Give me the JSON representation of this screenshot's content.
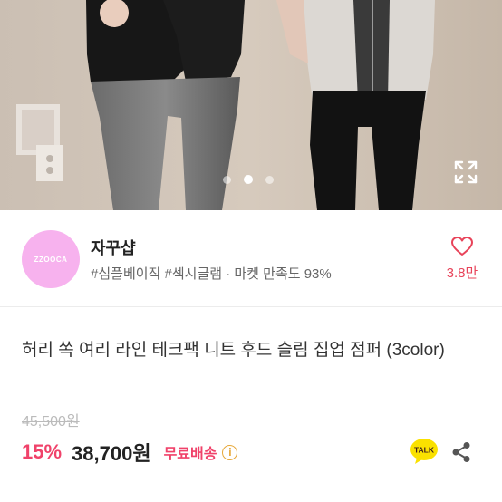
{
  "shop": {
    "avatar_text": "ZZOOCA",
    "name": "자꾸샵",
    "meta": "#심플베이직 #섹시글램 · 마켓 만족도 93%",
    "likes": "3.8만"
  },
  "product": {
    "title": "허리 쏙 여리 라인 테크팩 니트 후드 슬림 집업 점퍼 (3color)",
    "original_price": "45,500원",
    "discount": "15%",
    "price": "38,700원",
    "shipping": "무료배송",
    "info_glyph": "i",
    "talk_label": "TALK"
  },
  "carousel": {
    "total": 3,
    "active": 2
  },
  "colors": {
    "accent": "#f0426a",
    "heart": "#e8445a",
    "avatar": "#f7b2ee",
    "info": "#e7a83a"
  }
}
